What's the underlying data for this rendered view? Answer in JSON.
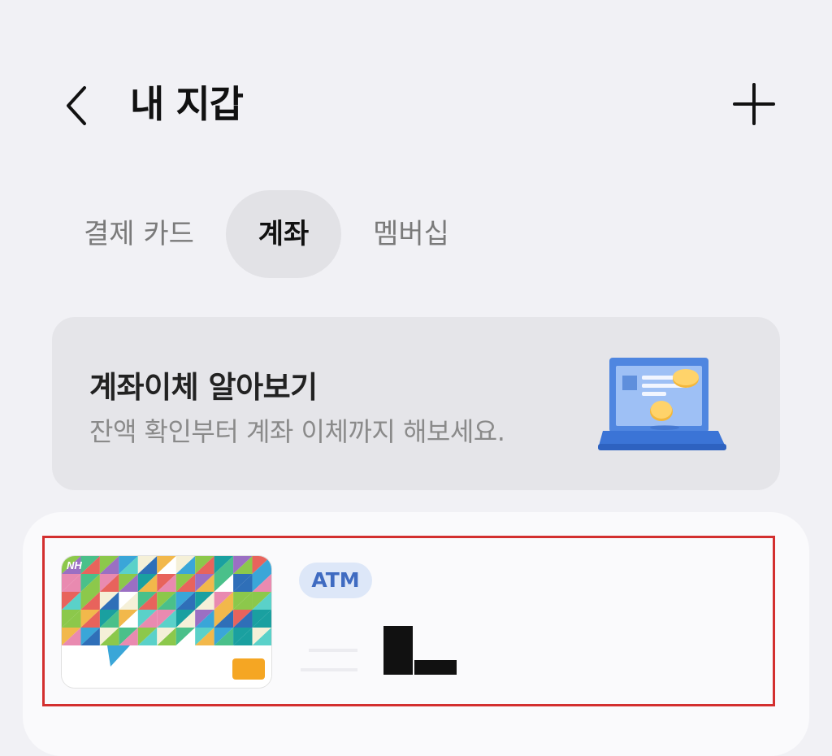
{
  "header": {
    "title": "내 지갑",
    "back_icon": "chevron-left-icon",
    "add_icon": "plus-icon"
  },
  "tabs": [
    {
      "label": "결제 카드",
      "active": false
    },
    {
      "label": "계좌",
      "active": true
    },
    {
      "label": "멤버십",
      "active": false
    }
  ],
  "promo": {
    "title": "계좌이체 알아보기",
    "subtitle": "잔액 확인부터 계좌 이체까지 해보세요.",
    "illustration": "laptop-coins-illustration"
  },
  "account_card": {
    "brand_mark": "NH",
    "badge": "ATM",
    "highlight_color": "#d32f2f"
  },
  "colors": {
    "background": "#f1f1f5",
    "active_tab_bg": "#e2e2e6",
    "badge_bg": "#dde7f8",
    "badge_text": "#3f6bc1"
  }
}
